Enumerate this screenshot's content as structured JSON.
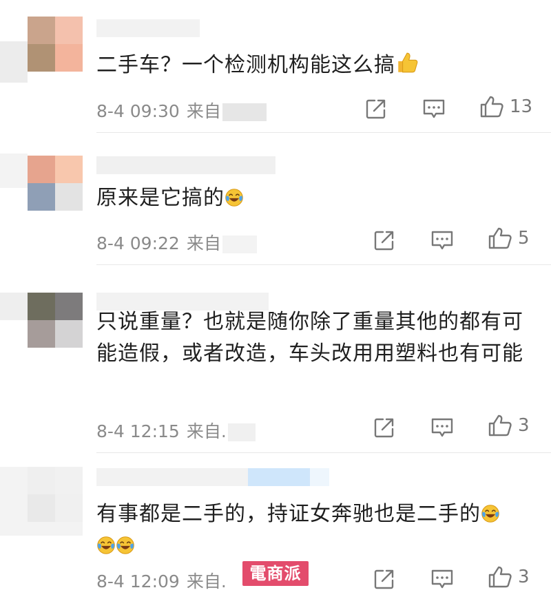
{
  "comments": [
    {
      "text": "二手车？一个检测机构能这么搞",
      "trailing_emoji": "thumbs-up",
      "time": "8-4 09:30",
      "source_prefix": "来自",
      "likes": "13",
      "avatar_colors": [
        "#caa48c",
        "#f4c1ad",
        "#b09274",
        "#f3b49c"
      ]
    },
    {
      "text": "原来是它搞的",
      "trailing_emoji": "tears-of-joy",
      "time": "8-4 09:22",
      "source_prefix": "来自",
      "likes": "5",
      "avatar_colors": [
        "#e6a48e",
        "#f8c7ad",
        "#8f9fb6",
        "#e3e3e3"
      ]
    },
    {
      "text": "只说重量？也就是随你除了重量其他的都有可能造假，或者改造，车头改用用塑料也有可能",
      "trailing_emoji": "",
      "time": "8-4 12:15",
      "source_prefix": "来自.",
      "likes": "3",
      "avatar_colors": [
        "#6e6d5e",
        "#7d7b7c",
        "#a69c9a",
        "#d4d3d4"
      ]
    },
    {
      "text": "有事都是二手的，持证女奔驰也是二手的",
      "trailing_emoji": "tears-of-joy",
      "extra_emojis": [
        "tears-of-joy",
        "tears-of-joy"
      ],
      "time": "8-4 12:09",
      "source_prefix": "来自.",
      "likes": "3",
      "avatar_colors": [
        "#efefef",
        "#f1f1f1",
        "#e9e9e9",
        "#f0f0f0"
      ]
    }
  ],
  "watermark": "電商派",
  "icons": {
    "share": "share-icon",
    "reply": "comment-icon",
    "like": "thumbs-up-icon"
  }
}
